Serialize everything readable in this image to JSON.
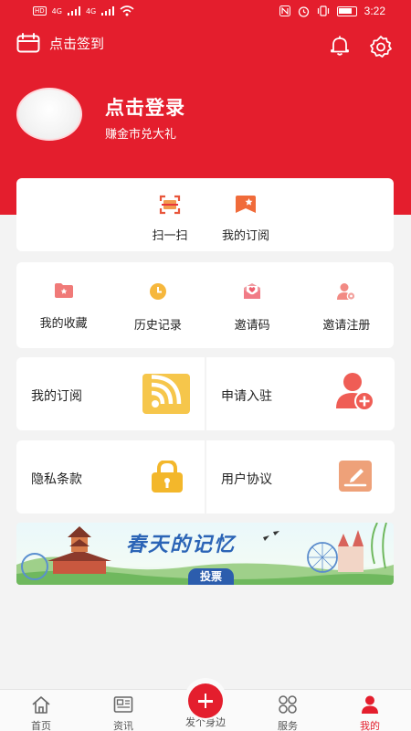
{
  "status_bar": {
    "time": "3:22",
    "signal1": "4G",
    "signal2": "4G",
    "tag": "HD"
  },
  "top_bar": {
    "checkin_label": "点击签到"
  },
  "profile": {
    "login_label": "点击登录",
    "subtitle": "赚金市兑大礼"
  },
  "quick_actions": [
    {
      "label": "扫一扫",
      "icon": "scan-icon"
    },
    {
      "label": "我的订阅",
      "icon": "bookmark-star-icon"
    }
  ],
  "features": [
    {
      "label": "我的收藏",
      "icon": "favorites-folder-icon"
    },
    {
      "label": "历史记录",
      "icon": "clock-icon"
    },
    {
      "label": "邀请码",
      "icon": "envelope-heart-icon"
    },
    {
      "label": "邀请注册",
      "icon": "user-settings-icon"
    }
  ],
  "tiles": [
    {
      "label": "我的订阅",
      "icon": "rss-icon"
    },
    {
      "label": "申请入驻",
      "icon": "add-user-icon"
    },
    {
      "label": "隐私条款",
      "icon": "lock-icon"
    },
    {
      "label": "用户协议",
      "icon": "edit-note-icon"
    }
  ],
  "banner": {
    "title": "春天的记忆",
    "button": "投票"
  },
  "tab_bar": {
    "items": [
      {
        "label": "首页",
        "icon": "home-icon"
      },
      {
        "label": "资讯",
        "icon": "news-icon"
      },
      {
        "label": "发个身边",
        "icon": "plus-icon"
      },
      {
        "label": "服务",
        "icon": "grid-icon"
      },
      {
        "label": "我的",
        "icon": "user-icon"
      }
    ],
    "active_index": 4
  },
  "colors": {
    "brand_red": "#e41e2d",
    "yellow": "#f6c64b",
    "salmon": "#ee7d6b"
  }
}
